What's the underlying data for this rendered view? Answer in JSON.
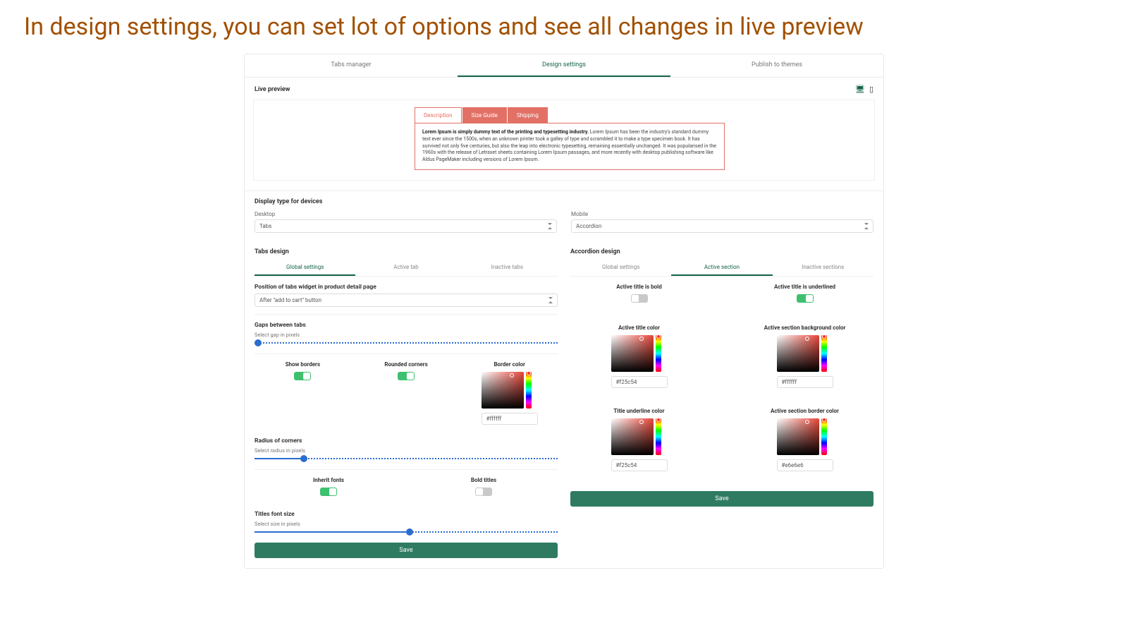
{
  "headline": "In design settings, you can set lot of options and see all changes in live preview",
  "topnav": {
    "tabs_manager": "Tabs manager",
    "design_settings": "Design settings",
    "publish": "Publish to themes"
  },
  "live_preview": {
    "title": "Live preview",
    "tabs": [
      "Description",
      "Size Guide",
      "Shipping"
    ],
    "body_bold": "Lorem Ipsum is simply dummy text of the printing and typesetting industry.",
    "body_rest": " Lorem Ipsum has been the industry's standard dummy text ever since the 1500s, when an unknown printer took a galley of type and scrambled it to make a type specimen book. It has survived not only five centuries, but also the leap into electronic typesetting, remaining essentially unchanged. It was popularised in the 1960s with the release of Letraset sheets containing Lorem Ipsum passages, and more recently with desktop publishing software like Aldus PageMaker including versions of Lorem Ipsum."
  },
  "display_type": {
    "heading": "Display type for devices",
    "desktop_label": "Desktop",
    "desktop_value": "Tabs",
    "mobile_label": "Mobile",
    "mobile_value": "Accordion"
  },
  "tabs_design": {
    "heading": "Tabs design",
    "subtabs": [
      "Global settings",
      "Active tab",
      "Inactive tabs"
    ],
    "position": {
      "label": "Position of tabs widget in product detail page",
      "value": "After \"add to cart\" button"
    },
    "gaps": {
      "heading": "Gaps between tabs",
      "slider_label": "Select gap in pixels"
    },
    "show_borders": "Show borders",
    "rounded_corners": "Rounded corners",
    "border_color": "Border color",
    "border_color_value": "#ffffff",
    "radius": {
      "heading": "Radius of corners",
      "slider_label": "Select radius in pixels"
    },
    "inherit_fonts": "Inherit fonts",
    "bold_titles": "Bold titles",
    "font_size": {
      "heading": "Titles font size",
      "slider_label": "Select size in pixels"
    },
    "save": "Save"
  },
  "accordion_design": {
    "heading": "Accordion design",
    "subtabs": [
      "Global settings",
      "Active section",
      "Inactive sections"
    ],
    "active_title_bold": "Active title is bold",
    "active_title_underlined": "Active title is underlined",
    "active_title_color": "Active title color",
    "active_title_color_value": "#f25c54",
    "active_bg": "Active section background color",
    "active_bg_value": "#ffffff",
    "underline_color": "Title underline color",
    "underline_color_value": "#f25c54",
    "border_color": "Active section border color",
    "border_color_value": "#e6e6e6",
    "save": "Save"
  }
}
